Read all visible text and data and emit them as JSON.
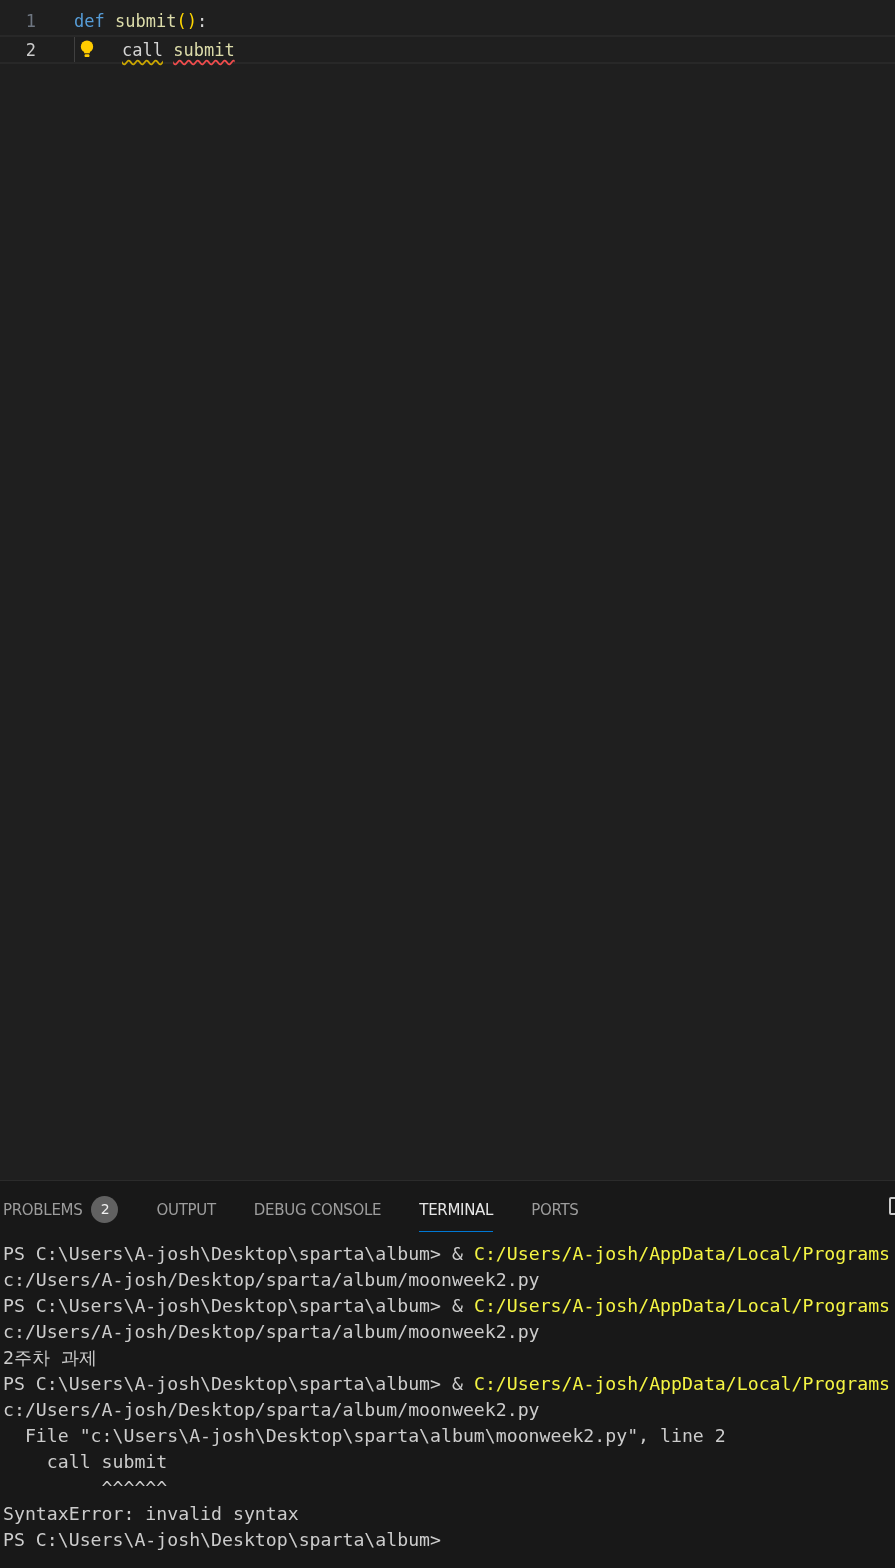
{
  "editor": {
    "lines": [
      {
        "number": "1",
        "current": false,
        "lightbulb": false,
        "tokens": [
          {
            "text": "def",
            "kind": "keyword",
            "warning": false,
            "error": false
          },
          {
            "text": " submit",
            "kind": "function",
            "warning": false,
            "error": false
          },
          {
            "text": "()",
            "kind": "bracket",
            "warning": false,
            "error": false
          },
          {
            "text": ":",
            "kind": "plain",
            "warning": false,
            "error": false
          }
        ]
      },
      {
        "number": "2",
        "current": true,
        "lightbulb": true,
        "tokens": [
          {
            "text": "call",
            "kind": "variable",
            "warning": true,
            "error": false
          },
          {
            "text": " submit",
            "kind": "function",
            "warning": false,
            "error": true
          }
        ]
      }
    ]
  },
  "panel": {
    "tabs": [
      {
        "label": "PROBLEMS",
        "selected": false,
        "badge": "2"
      },
      {
        "label": "OUTPUT",
        "selected": false
      },
      {
        "label": "DEBUG CONSOLE",
        "selected": false
      },
      {
        "label": "TERMINAL",
        "selected": true
      },
      {
        "label": "PORTS",
        "selected": false
      }
    ],
    "terminal": [
      {
        "kind": "command",
        "prompt": "PS C:\\Users\\A-josh\\Desktop\\sparta\\album>",
        "operator": "&",
        "path": "C:/Users/A-josh/AppData/Local/Programs"
      },
      {
        "kind": "output",
        "text": "c:/Users/A-josh/Desktop/sparta/album/moonweek2.py"
      },
      {
        "kind": "command",
        "prompt": "PS C:\\Users\\A-josh\\Desktop\\sparta\\album>",
        "operator": "&",
        "path": "C:/Users/A-josh/AppData/Local/Programs"
      },
      {
        "kind": "output",
        "text": "c:/Users/A-josh/Desktop/sparta/album/moonweek2.py"
      },
      {
        "kind": "output",
        "text": "2주차 과제"
      },
      {
        "kind": "command",
        "prompt": "PS C:\\Users\\A-josh\\Desktop\\sparta\\album>",
        "operator": "&",
        "path": "C:/Users/A-josh/AppData/Local/Programs"
      },
      {
        "kind": "output",
        "text": "c:/Users/A-josh/Desktop/sparta/album/moonweek2.py"
      },
      {
        "kind": "output",
        "text": "  File \"c:\\Users\\A-josh\\Desktop\\sparta\\album\\moonweek2.py\", line 2"
      },
      {
        "kind": "output",
        "text": "    call submit"
      },
      {
        "kind": "output",
        "text": "         ^^^^^^"
      },
      {
        "kind": "output",
        "text": "SyntaxError: invalid syntax"
      },
      {
        "kind": "prompt",
        "prompt": "PS C:\\Users\\A-josh\\Desktop\\sparta\\album>"
      }
    ]
  }
}
